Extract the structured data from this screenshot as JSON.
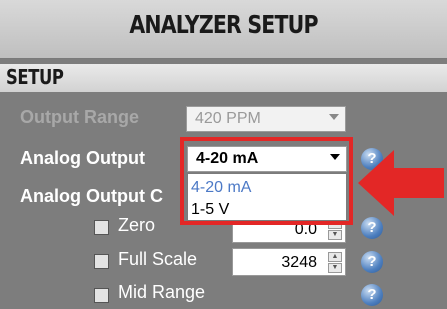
{
  "header": {
    "title": "ANALYZER SETUP"
  },
  "section": {
    "title": "SETUP"
  },
  "output_range": {
    "label": "Output Range",
    "value": "420 PPM"
  },
  "analog_output": {
    "label": "Analog Output",
    "value": "4-20 mA",
    "options": [
      "4-20 mA",
      "1-5 V"
    ]
  },
  "analog_output_c": {
    "label": "Analog Output C"
  },
  "rows": {
    "zero": {
      "label": "Zero",
      "value": "0.0"
    },
    "full_scale": {
      "label": "Full Scale",
      "value": "3248"
    },
    "mid_range": {
      "label": "Mid Range"
    }
  },
  "help_glyph": "?",
  "colors": {
    "highlight": "#e32726",
    "option_selected": "#4c79c6",
    "help_icon": "#4d7fbf"
  }
}
